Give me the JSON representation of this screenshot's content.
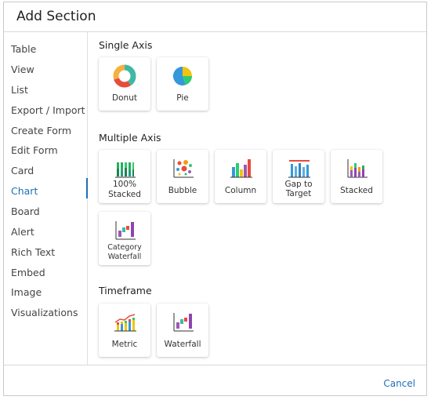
{
  "dialog": {
    "title": "Add Section",
    "cancel_label": "Cancel"
  },
  "sidebar": {
    "items": [
      {
        "label": "Table"
      },
      {
        "label": "View"
      },
      {
        "label": "List"
      },
      {
        "label": "Export / Import"
      },
      {
        "label": "Create Form"
      },
      {
        "label": "Edit Form"
      },
      {
        "label": "Card"
      },
      {
        "label": "Chart",
        "active": true
      },
      {
        "label": "Board"
      },
      {
        "label": "Alert"
      },
      {
        "label": "Rich Text"
      },
      {
        "label": "Embed"
      },
      {
        "label": "Image"
      },
      {
        "label": "Visualizations"
      }
    ]
  },
  "sections": {
    "single_axis": {
      "label": "Single Axis",
      "cards": [
        {
          "label": "Donut",
          "icon": "donut-chart-icon"
        },
        {
          "label": "Pie",
          "icon": "pie-chart-icon"
        }
      ]
    },
    "multiple_axis": {
      "label": "Multiple Axis",
      "cards": [
        {
          "line1": "100%",
          "line2": "Stacked",
          "icon": "stacked-100-chart-icon"
        },
        {
          "label": "Bubble",
          "icon": "bubble-chart-icon"
        },
        {
          "label": "Column",
          "icon": "column-chart-icon"
        },
        {
          "line1": "Gap to",
          "line2": "Target",
          "icon": "gap-to-target-chart-icon"
        },
        {
          "label": "Stacked",
          "icon": "stacked-chart-icon"
        },
        {
          "line1": "Category",
          "line2": "Waterfall",
          "icon": "category-waterfall-chart-icon"
        }
      ]
    },
    "timeframe": {
      "label": "Timeframe",
      "cards": [
        {
          "label": "Metric",
          "icon": "metric-chart-icon"
        },
        {
          "label": "Waterfall",
          "icon": "waterfall-chart-icon"
        }
      ]
    }
  },
  "colors": {
    "accent": "#1f6fb5",
    "border": "#c9c9c9"
  }
}
